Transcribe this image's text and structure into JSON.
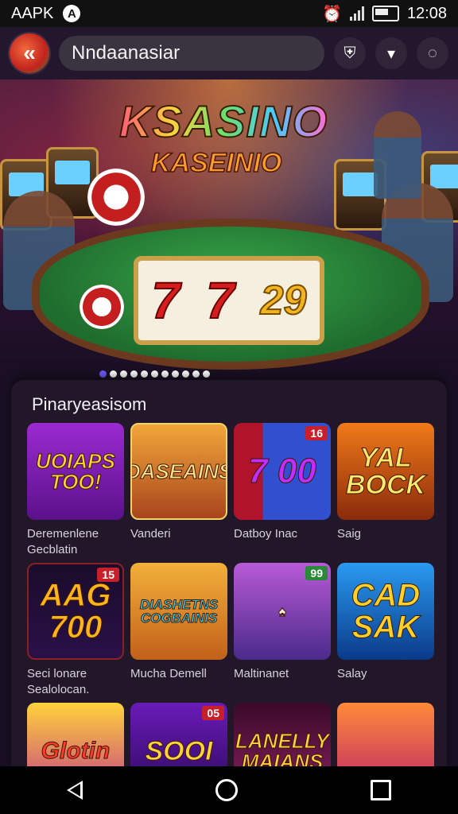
{
  "status_bar": {
    "app_label": "AAPK",
    "notif_glyph": "A",
    "time": "12:08"
  },
  "app_bar": {
    "back_glyph": "«",
    "search_text": "Nndaanasiar"
  },
  "hero": {
    "logo_line1": "KSASINO",
    "logo_line2": "KASEINIO",
    "reel1": "7",
    "reel2": "7",
    "reel3": "29"
  },
  "section": {
    "title": "Pinaryeasisom"
  },
  "games": [
    {
      "art": "UOIAPS TOO!",
      "badge": "",
      "caption": "Deremenlene Gecblatin"
    },
    {
      "art": "DASEAINS",
      "badge": "",
      "caption": "Vanderi"
    },
    {
      "art": "7 00",
      "badge": "16",
      "caption": "Datboy Inac"
    },
    {
      "art": "YAL BOCK",
      "badge": "",
      "caption": "Saig"
    },
    {
      "art": "AAG 700",
      "badge": "15",
      "caption": "Seci lonare Sealolocan."
    },
    {
      "art": "DIASHETNS COGBAINIS",
      "badge": "",
      "caption": "Mucha Demell"
    },
    {
      "art": "♠",
      "badge": "99",
      "caption": "Maltinanet"
    },
    {
      "art": "CAD SAK",
      "badge": "",
      "caption": "Salay"
    },
    {
      "art": "Glotin",
      "badge": "",
      "caption": ""
    },
    {
      "art": "SOOI",
      "badge": "05",
      "caption": ""
    },
    {
      "art": "LANELLY MAIANS",
      "badge": "",
      "caption": ""
    },
    {
      "art": "",
      "badge": "",
      "caption": ""
    }
  ],
  "icons": {
    "notification": "shield-icon",
    "bookmark": "bookmark-icon",
    "loading": "spinner-icon"
  }
}
